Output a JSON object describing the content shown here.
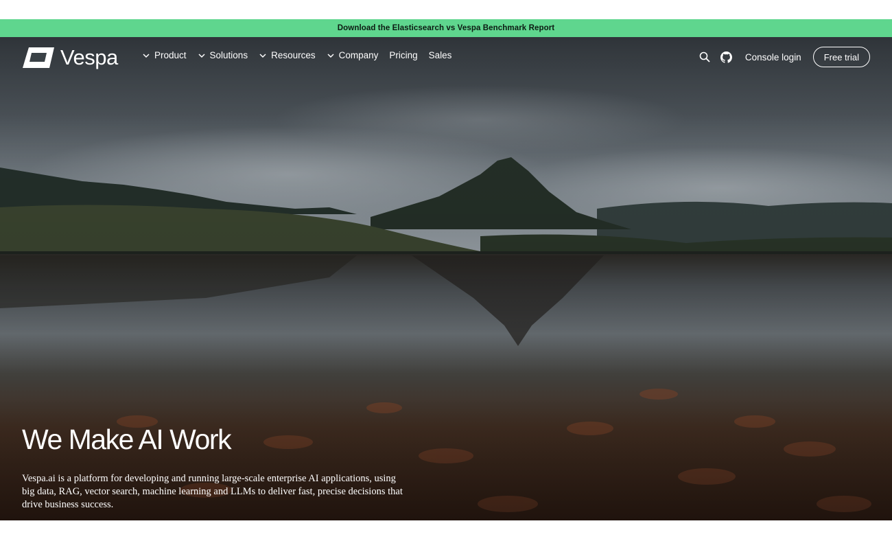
{
  "banner": {
    "text": "Download the Elasticsearch vs Vespa Benchmark Report"
  },
  "logo": {
    "text": "Vespa",
    "icon": "vespa-logo-icon"
  },
  "nav": {
    "items": [
      {
        "label": "Product",
        "has_dropdown": true
      },
      {
        "label": "Solutions",
        "has_dropdown": true
      },
      {
        "label": "Resources",
        "has_dropdown": true
      },
      {
        "label": "Company",
        "has_dropdown": true
      },
      {
        "label": "Pricing",
        "has_dropdown": false
      },
      {
        "label": "Sales",
        "has_dropdown": false
      }
    ],
    "search_icon": "search-icon",
    "github_icon": "github-icon",
    "console_login": "Console login",
    "free_trial": "Free trial"
  },
  "hero": {
    "headline": "We Make AI Work",
    "description": "Vespa.ai is a platform for developing and running large-scale enterprise AI applications, using big data, RAG, vector search, machine learning and LLMs to deliver fast, precise decisions that drive business success."
  },
  "colors": {
    "banner": "#5fd68e",
    "text_on_hero": "#ffffff",
    "banner_text": "#0c1a12"
  }
}
